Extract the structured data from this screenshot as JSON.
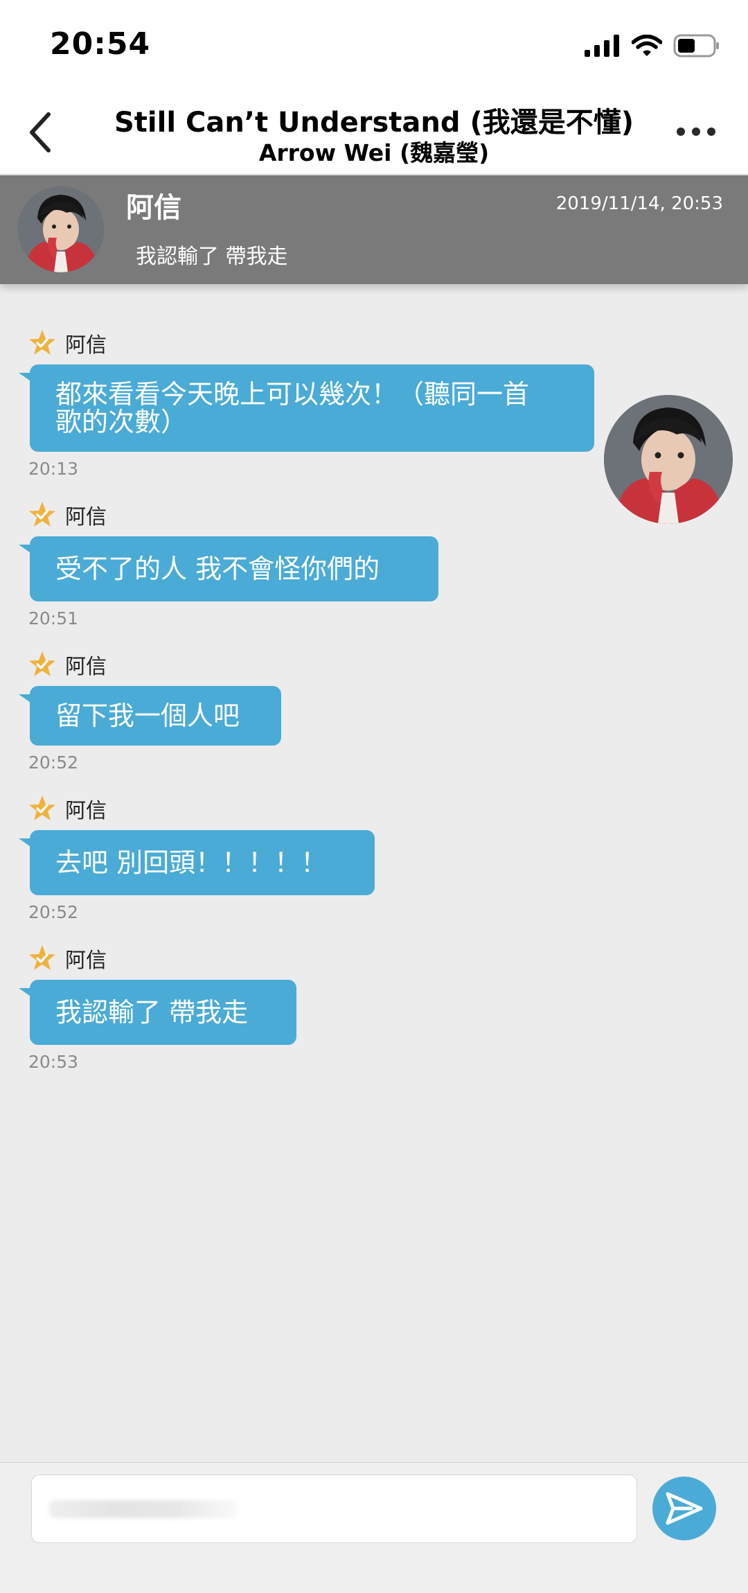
{
  "status_bar": {
    "time": "20:54",
    "icons": [
      "signal-icon",
      "wifi-icon",
      "battery-icon"
    ]
  },
  "header": {
    "title": "Still Can’t Understand (我還是不懂)",
    "subtitle": "Arrow Wei (魏嘉瑩)",
    "back_icon": "chevron-left-icon",
    "more_icon": "more-horizontal-icon"
  },
  "pinned": {
    "name": "阿信",
    "date": "2019/11/14, 20:53",
    "text": "我認輸了  帶我走"
  },
  "messages": [
    {
      "sender": "阿信",
      "text": "都來看看今天晚上可以幾次！（聽同一首\n歌的次數）",
      "time": "20:13"
    },
    {
      "sender": "阿信",
      "text": "受不了的人  我不會怪你們的",
      "time": "20:51"
    },
    {
      "sender": "阿信",
      "text": "留下我一個人吧",
      "time": "20:52"
    },
    {
      "sender": "阿信",
      "text": "去吧  別回頭！！！！！",
      "time": "20:52"
    },
    {
      "sender": "阿信",
      "text": "我認輸了  帶我走",
      "time": "20:53"
    }
  ],
  "composer": {
    "placeholder": "",
    "send_icon": "send-icon"
  },
  "colors": {
    "bubble": "#4aabd6",
    "banner": "#7a7a7a",
    "star": "#f0b23c",
    "background": "#ececec"
  }
}
